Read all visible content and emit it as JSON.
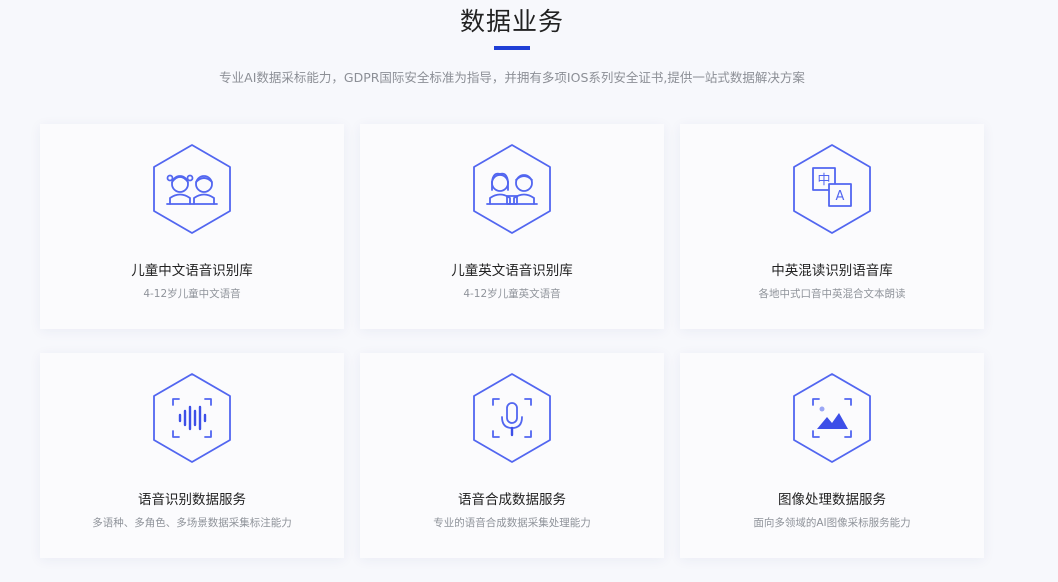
{
  "header": {
    "title": "数据业务",
    "subtitle": "专业AI数据采标能力，GDPR国际安全标准为指导，并拥有多项IOS系列安全证书,提供一站式数据解决方案"
  },
  "colors": {
    "accent": "#1f3fd6",
    "icon_stroke": "#5266f0"
  },
  "services": [
    {
      "icon": "children-chinese-icon",
      "title": "儿童中文语音识别库",
      "desc": "4-12岁儿童中文语音"
    },
    {
      "icon": "children-english-icon",
      "title": "儿童英文语音识别库",
      "desc": "4-12岁儿童英文语音"
    },
    {
      "icon": "translate-icon",
      "title": "中英混读识别语音库",
      "desc": "各地中式口音中英混合文本朗读"
    },
    {
      "icon": "sound-wave-icon",
      "title": "语音识别数据服务",
      "desc": "多语种、多角色、多场景数据采集标注能力"
    },
    {
      "icon": "microphone-icon",
      "title": "语音合成数据服务",
      "desc": "专业的语音合成数据采集处理能力"
    },
    {
      "icon": "image-icon",
      "title": "图像处理数据服务",
      "desc": "面向多领域的AI图像采标服务能力"
    }
  ],
  "icon_labels": {
    "translate_cn": "中",
    "translate_en": "A"
  }
}
